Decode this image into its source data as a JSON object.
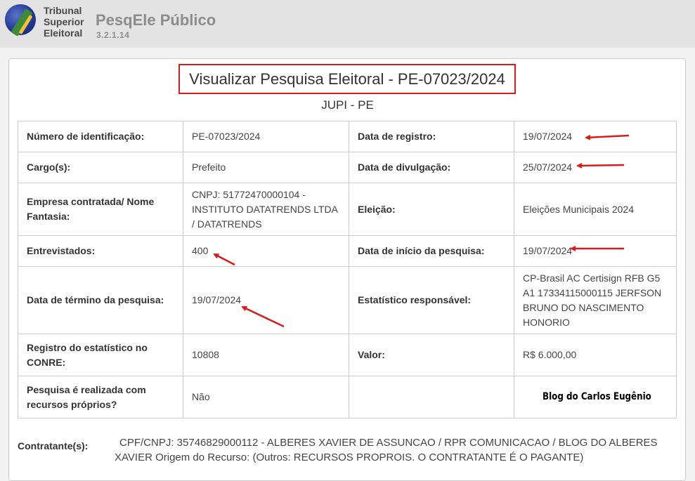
{
  "header": {
    "logo_lines": [
      "Tribunal",
      "Superior",
      "Eleitoral"
    ],
    "app_title": "PesqEle Público",
    "version": "3.2.1.14"
  },
  "page": {
    "title": "Visualizar Pesquisa Eleitoral - PE-07023/2024",
    "subtitle": "JUPI - PE"
  },
  "rows": [
    {
      "label1": "Número de identificação:",
      "value1": "PE-07023/2024",
      "label2": "Data de registro:",
      "value2": "19/07/2024"
    },
    {
      "label1": "Cargo(s):",
      "value1": "Prefeito",
      "label2": "Data de divulgação:",
      "value2": "25/07/2024"
    },
    {
      "label1": "Empresa contratada/ Nome Fantasia:",
      "value1": "CNPJ: 51772470000104 - INSTITUTO DATATRENDS LTDA / DATATRENDS",
      "label2": "Eleição:",
      "value2": "Eleições Municipais 2024"
    },
    {
      "label1": "Entrevistados:",
      "value1": "400",
      "label2": "Data de início da pesquisa:",
      "value2": "19/07/2024"
    },
    {
      "label1": "Data de término da pesquisa:",
      "value1": "19/07/2024",
      "label2": "Estatístico responsável:",
      "value2": "CP-Brasil AC Certisign RFB G5 A1 17334115000115 JERFSON BRUNO DO NASCIMENTO HONORIO"
    },
    {
      "label1": "Registro do estatístico no CONRE:",
      "value1": "10808",
      "label2": "Valor:",
      "value2": "R$ 6.000,00"
    },
    {
      "label1": "Pesquisa é realizada com recursos próprios?",
      "value1": "Não",
      "label2": "",
      "value2": ""
    }
  ],
  "watermark": "Blog do Carlos Eugênio",
  "contratante": {
    "label": "Contratante(s):",
    "value": "CPF/CNPJ: 35746829000112 - ALBERES XAVIER DE ASSUNCAO / RPR COMUNICACAO / BLOG DO ALBERES XAVIER Origem do Recurso: (Outros: RECURSOS PROPROIS. O CONTRATANTE É O PAGANTE)"
  },
  "colors": {
    "annotation_red": "#d81b1b",
    "header_bg": "#e3e3e3"
  }
}
